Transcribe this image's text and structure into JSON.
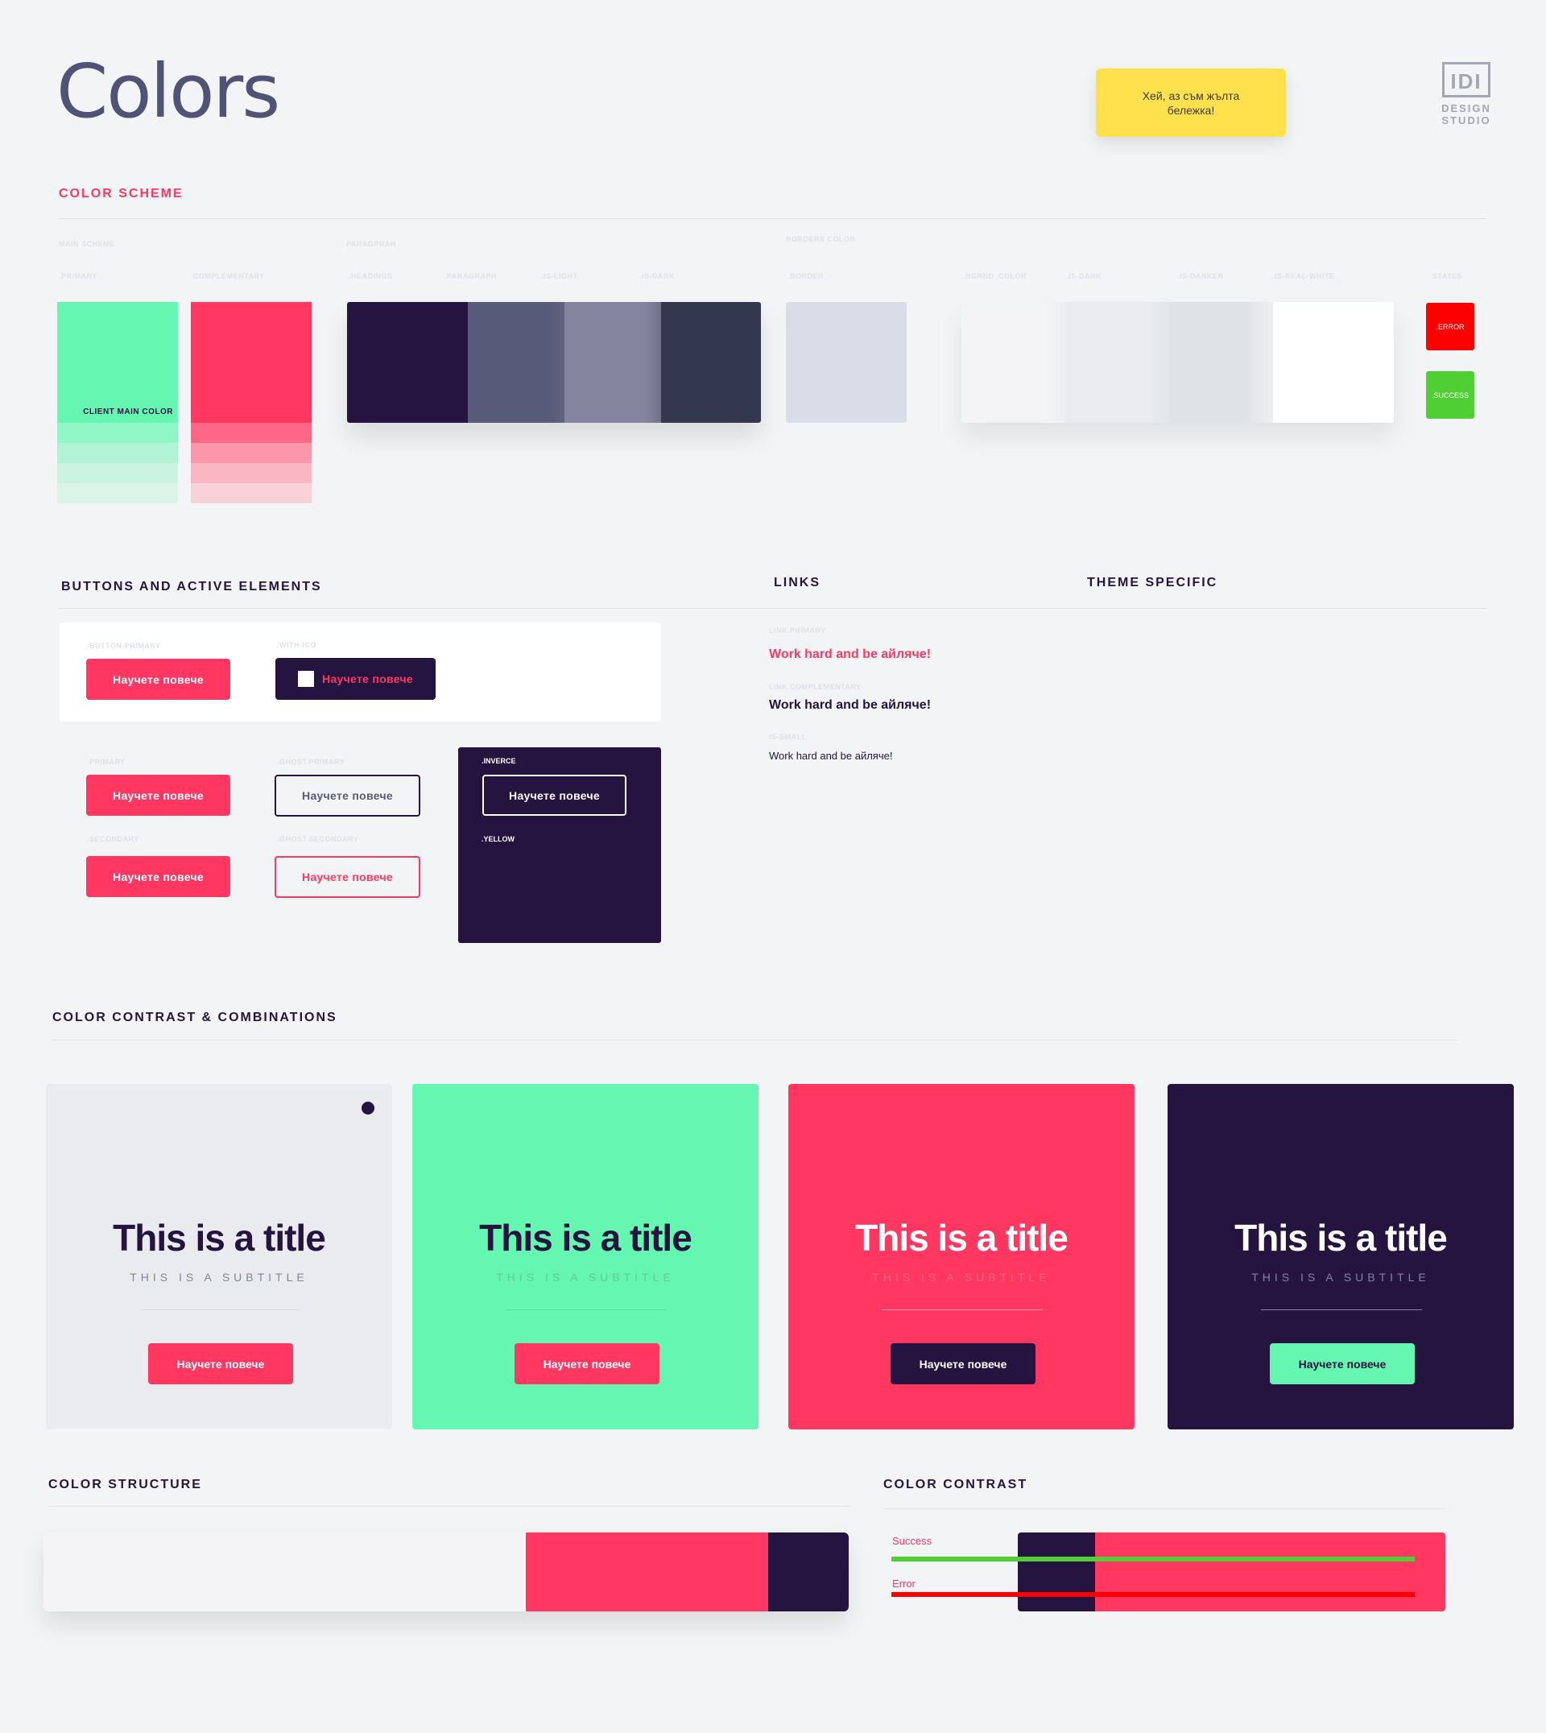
{
  "header": {
    "title": "Colors",
    "sticky_note": "Хей, аз съм жълта бележка!",
    "logo_mark": "IDI",
    "logo_text_1": "DESIGN",
    "logo_text_2": "STUDIO"
  },
  "color_scheme": {
    "title": "COLOR SCHEME",
    "main_scheme_label": "MAIN SCHEME",
    "paragraph_group_label": "PARAGPRAH",
    "borders_group_label": "BORDERS COLOR",
    "primary_label": ".PRIMARY",
    "complementary_label": ".COMPLEMENTARY",
    "headings_label": ".HEADINGS",
    "paragraph_label": ".PARAGRAPH",
    "is_light_label": ".IS-LIGHT",
    "is_dark_label": ".IS-DARK",
    "border_label": ".BORDER",
    "bgrnd_label": ".BGRND_COLOR",
    "bg_is_dark_label": ".IS-DARK",
    "bg_is_darker_label": ".IS-DARKER",
    "bg_is_real_white_label": ".IS-REAL-WHITE",
    "states_label": "STATES",
    "client_main_color": "CLIENT MAIN COLOR",
    "error_label": ".ERROR",
    "success_label": ".SUCCESS",
    "colors": {
      "primary": "#65f7b1",
      "complementary": "#ff3761",
      "headings": "#24143f",
      "paragraph": "#575a78",
      "is_light": "#82859d",
      "is_dark": "#34384e",
      "border": "#d9dde8",
      "bgrnd": "#f4f4f6",
      "bg_is_dark": "#e9ebee",
      "bg_is_darker": "#e0e3e6",
      "real_white": "#ffffff",
      "error": "#ff0000",
      "success": "#4fcf34"
    }
  },
  "buttons": {
    "title": "BUTTONS AND ACTIVE ELEMENTS",
    "button_primary_label": ".BUTTON-PRIMARY",
    "with_ico_label": ".WITH-ICO",
    "primary_label": ".PRIMARY",
    "ghost_primary_label": ".GHOST.PRIMARY",
    "secondary_label": ".SECONDARY",
    "ghost_secondary_label": ".GHOST.SECONDARY",
    "inverce_label": ".INVERCE",
    "yellow_label": ".YELLOW",
    "cta": "Научете повече"
  },
  "links": {
    "title": "LINKS",
    "link_primary_label": "LINK.PRIMARY",
    "link_complementary_label": "LINK.COMPLEMENTARY",
    "is_small_label": "IS-SMALL",
    "text": "Work hard and be айляче!"
  },
  "theme": {
    "title": "THEME SPECIFIC"
  },
  "contrast_combos": {
    "title": "COLOR CONTRAST & COMBINATIONS",
    "cards": [
      {
        "title": "This is a title",
        "subtitle": "THIS IS A SUBTITLE",
        "button": "Научете повече"
      },
      {
        "title": "This is a title",
        "subtitle": "THIS IS A SUBTITLE",
        "button": "Научете повече"
      },
      {
        "title": "This is a title",
        "subtitle": "THIS IS A SUBTITLE",
        "button": "Научете повече"
      },
      {
        "title": "This is a title",
        "subtitle": "THIS IS A SUBTITLE",
        "button": "Научете повече"
      }
    ]
  },
  "structure": {
    "title": "COLOR STRUCTURE"
  },
  "contrast": {
    "title": "COLOR CONTRAST",
    "success_label": "Success",
    "error_label": "Error"
  }
}
